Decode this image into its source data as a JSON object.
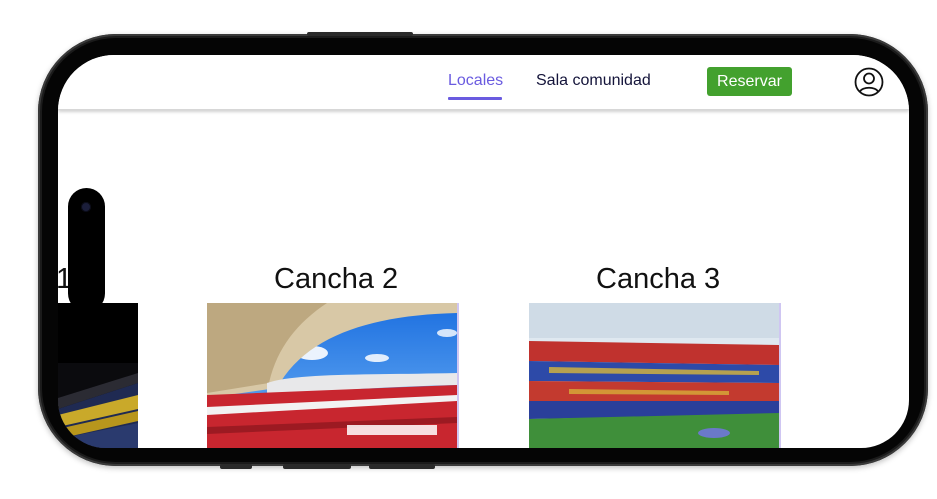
{
  "nav": {
    "items": [
      {
        "label": "Locales",
        "active": true
      },
      {
        "label": "Sala comunidad",
        "active": false
      }
    ],
    "reserve_label": "Reservar",
    "user_icon": "user-circle-icon"
  },
  "courts": [
    {
      "title": "1",
      "image": "stadium-yellow-stands"
    },
    {
      "title": "Cancha 2",
      "image": "stadium-red-seats-sky"
    },
    {
      "title": "Cancha 3",
      "image": "stadium-blue-red-mosaic"
    }
  ],
  "colors": {
    "accent": "#6a5be0",
    "reserve_button": "#43a12e",
    "nav_text": "#14143a"
  }
}
